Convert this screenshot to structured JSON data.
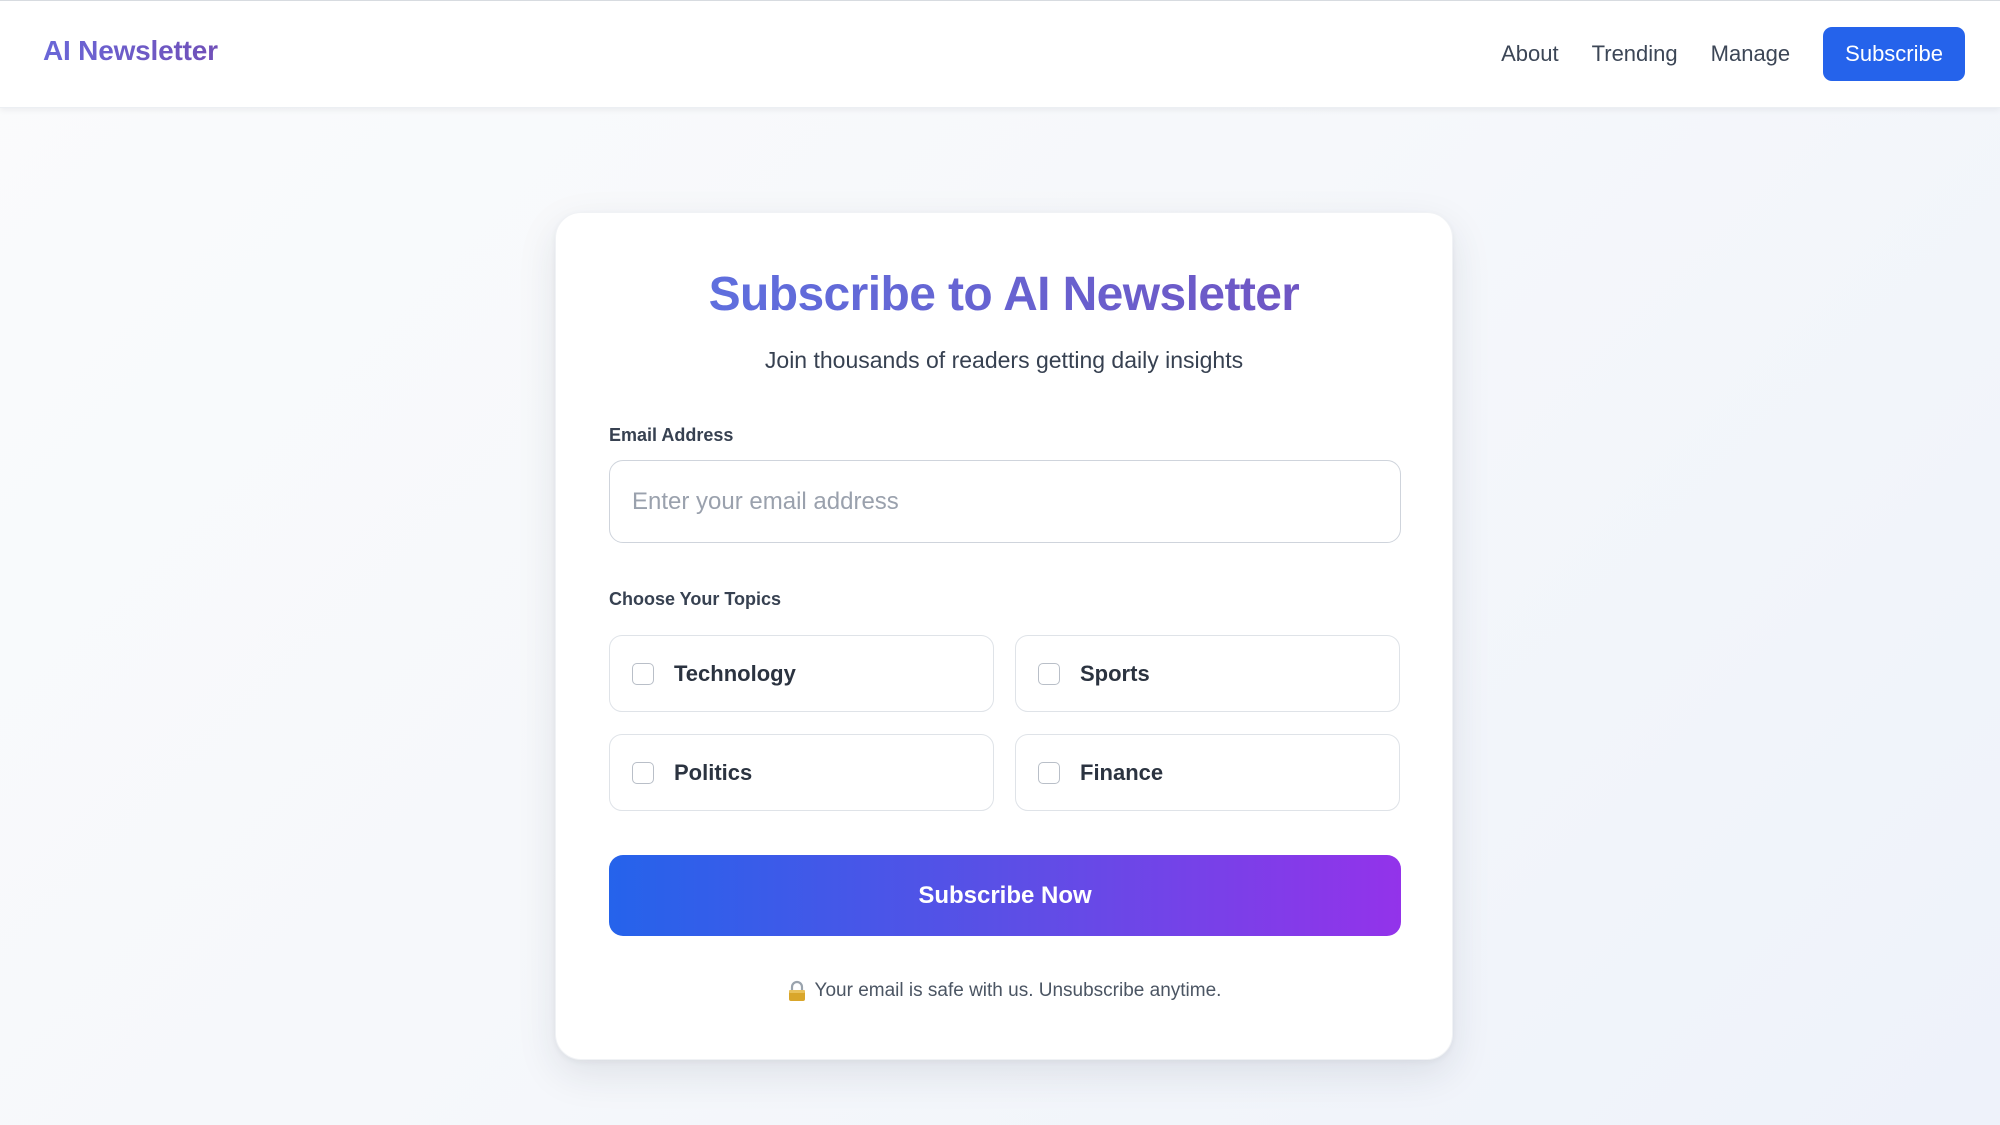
{
  "header": {
    "brand": "AI Newsletter",
    "nav": [
      {
        "label": "About"
      },
      {
        "label": "Trending"
      },
      {
        "label": "Manage"
      }
    ],
    "cta_label": "Subscribe"
  },
  "form": {
    "title": "Subscribe to AI Newsletter",
    "subtitle": "Join thousands of readers getting daily insights",
    "email_label": "Email Address",
    "email_placeholder": "Enter your email address",
    "email_value": "",
    "topics_label": "Choose Your Topics",
    "topics": [
      {
        "label": "Technology",
        "checked": false
      },
      {
        "label": "Sports",
        "checked": false
      },
      {
        "label": "Politics",
        "checked": false
      },
      {
        "label": "Finance",
        "checked": false
      }
    ],
    "submit_label": "Subscribe Now",
    "privacy_note": "Your email is safe with us. Unsubscribe anytime.",
    "privacy_icon": "lock-icon"
  },
  "colors": {
    "accent": "#2563eb",
    "gradient_start": "#2563eb",
    "gradient_end": "#9333ea",
    "title": "#6366d1"
  }
}
